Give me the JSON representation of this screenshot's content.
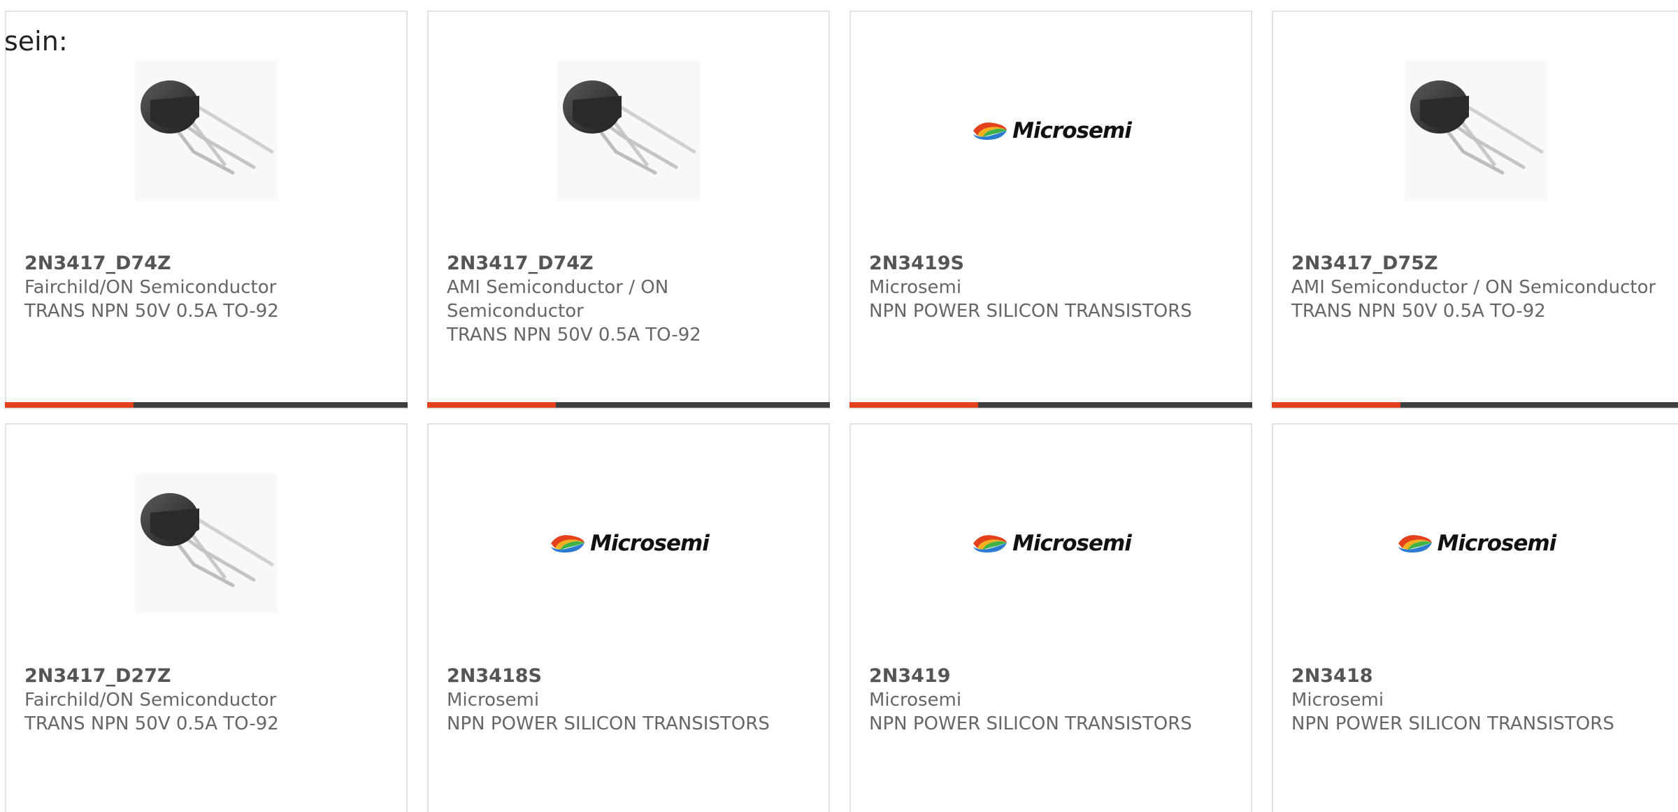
{
  "page": {
    "heading": "sein:"
  },
  "logo_text": "Microsemi",
  "colors": {
    "accent": "#e4401c",
    "bar": "#3f3f3f",
    "card_border": "#e2e2e2",
    "text": "#666666"
  },
  "products": [
    {
      "part": "2N3417_D74Z",
      "manufacturer": "Fairchild/ON Semiconductor",
      "description": "TRANS NPN 50V 0.5A TO-92",
      "image": "transistor-to92-image",
      "has_accent_bar": true
    },
    {
      "part": "2N3417_D74Z",
      "manufacturer": "AMI Semiconductor / ON Semiconductor",
      "description": "TRANS NPN 50V 0.5A TO-92",
      "image": "transistor-to92-image",
      "has_accent_bar": true
    },
    {
      "part": "2N3419S",
      "manufacturer": "Microsemi",
      "description": "NPN POWER SILICON TRANSISTORS",
      "image": "microsemi-logo",
      "has_accent_bar": true
    },
    {
      "part": "2N3417_D75Z",
      "manufacturer": "AMI Semiconductor / ON Semiconductor",
      "description": "TRANS NPN 50V 0.5A TO-92",
      "image": "transistor-to92-image",
      "has_accent_bar": true
    },
    {
      "part": "2N3417_D27Z",
      "manufacturer": "Fairchild/ON Semiconductor",
      "description": "TRANS NPN 50V 0.5A TO-92",
      "image": "transistor-to92-image",
      "has_accent_bar": false
    },
    {
      "part": "2N3418S",
      "manufacturer": "Microsemi",
      "description": "NPN POWER SILICON TRANSISTORS",
      "image": "microsemi-logo",
      "has_accent_bar": false
    },
    {
      "part": "2N3419",
      "manufacturer": "Microsemi",
      "description": "NPN POWER SILICON TRANSISTORS",
      "image": "microsemi-logo",
      "has_accent_bar": false
    },
    {
      "part": "2N3418",
      "manufacturer": "Microsemi",
      "description": "NPN POWER SILICON TRANSISTORS",
      "image": "microsemi-logo",
      "has_accent_bar": false
    }
  ]
}
